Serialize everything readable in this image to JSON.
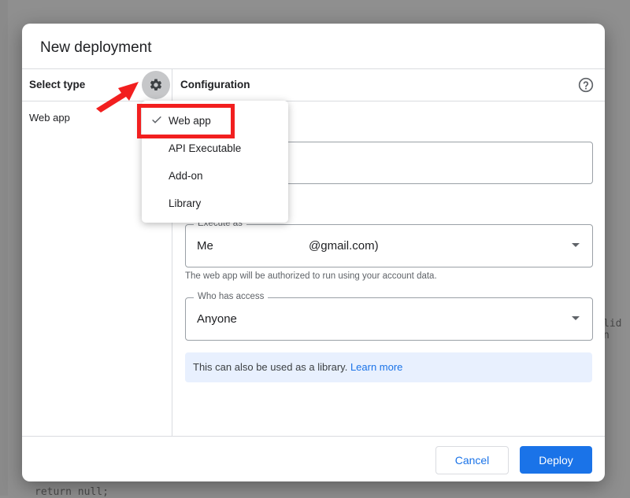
{
  "background": {
    "code_fragment_right": "lid n",
    "code_fragment_bottom": "return null;"
  },
  "dialog": {
    "title": "New deployment",
    "left_panel": {
      "header": "Select type",
      "gear_icon": "gear-icon",
      "items": [
        "Web app"
      ]
    },
    "right_panel": {
      "header": "Configuration",
      "help_icon": "help-circle-icon",
      "execute_as": {
        "legend": "Execute as",
        "value_prefix": "Me",
        "value_suffix": "@gmail.com)"
      },
      "execute_as_helper": "The web app will be authorized to run using your account data.",
      "who_has_access": {
        "legend": "Who has access",
        "value": "Anyone"
      },
      "info": {
        "text": "This can also be used as a library.",
        "link": "Learn more"
      }
    },
    "footer": {
      "cancel_label": "Cancel",
      "deploy_label": "Deploy"
    }
  },
  "type_menu": {
    "selected": "Web app",
    "items": [
      "Web app",
      "API Executable",
      "Add-on",
      "Library"
    ]
  },
  "colors": {
    "accent": "#1a73e8",
    "annotation": "#f21f1f",
    "info_bg": "#e8f0fe"
  }
}
